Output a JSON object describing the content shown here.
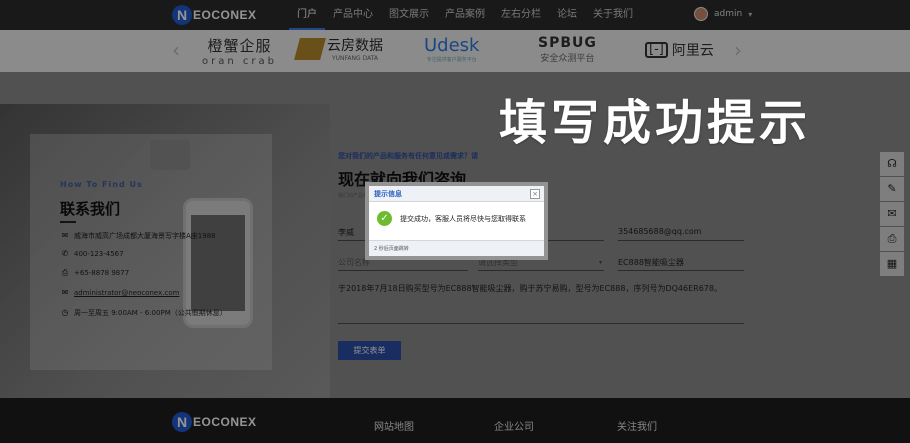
{
  "header": {
    "logo_letter": "N",
    "logo_text": "EOCONEX",
    "nav": [
      "门户",
      "产品中心",
      "图文展示",
      "产品案例",
      "左右分栏",
      "论坛",
      "关于我们"
    ],
    "username": "admin",
    "caret": "▾"
  },
  "partners": {
    "prev_arrow": "‹",
    "next_arrow": "›",
    "items": [
      {
        "name": "橙蟹企服",
        "sub": "oran crab"
      },
      {
        "name": "云房数据",
        "sub": "YUNFANG DATA"
      },
      {
        "name": "Udesk",
        "sub": "专注提供客户服务平台"
      },
      {
        "name": "SPBUG",
        "sub": "安全众测平台"
      },
      {
        "name": "阿里云",
        "mark": "[-]"
      }
    ]
  },
  "contact": {
    "kicker": "How To Find Us",
    "title": "联系我们",
    "address": "威海市威高广场成都大厦海景写字楼A座1988",
    "phone": "400-123-4567",
    "fax": "+65-8878 9877",
    "email": "administrator@neoconex.com",
    "hours": "周一至周五 9:00AM - 6:00PM（公共假期休息）"
  },
  "form": {
    "question": "您对我们的产品和服务有任何意见或需求？请",
    "title": "现在就向我们咨询",
    "subtitle": "我们的产品和服务有任何意见或需求，请您留下联系方式，我们将尽快与您取得联系",
    "name": "李威",
    "phone_value": "",
    "email_value": "354685688@qq.com",
    "company": "公司名称",
    "type": "请选择类型",
    "product": "EC888智能吸尘器",
    "message": "于2018年7月18日购买型号为EC888智能吸尘器，购于苏宁易购，型号为EC888，序列号为DQ46ER678。",
    "submit": "提交表单"
  },
  "caption": "填写成功提示",
  "side_tools": [
    "headset-icon",
    "edit-icon",
    "mail-icon",
    "print-icon",
    "qrcode-icon"
  ],
  "dialog": {
    "title": "提示信息",
    "close": "×",
    "check": "✓",
    "message": "提交成功，客服人员将尽快与您取得联系",
    "footer": "2 秒后页面跳转"
  },
  "footer": {
    "logo_letter": "N",
    "logo_text": "EOCONEX",
    "links": [
      "网站地图",
      "企业公司",
      "关注我们"
    ]
  },
  "colors": {
    "accent": "#2b4ea8",
    "topbar": "#2b2b2b",
    "footer": "#1e1e1e",
    "success": "#6dbb2e"
  }
}
